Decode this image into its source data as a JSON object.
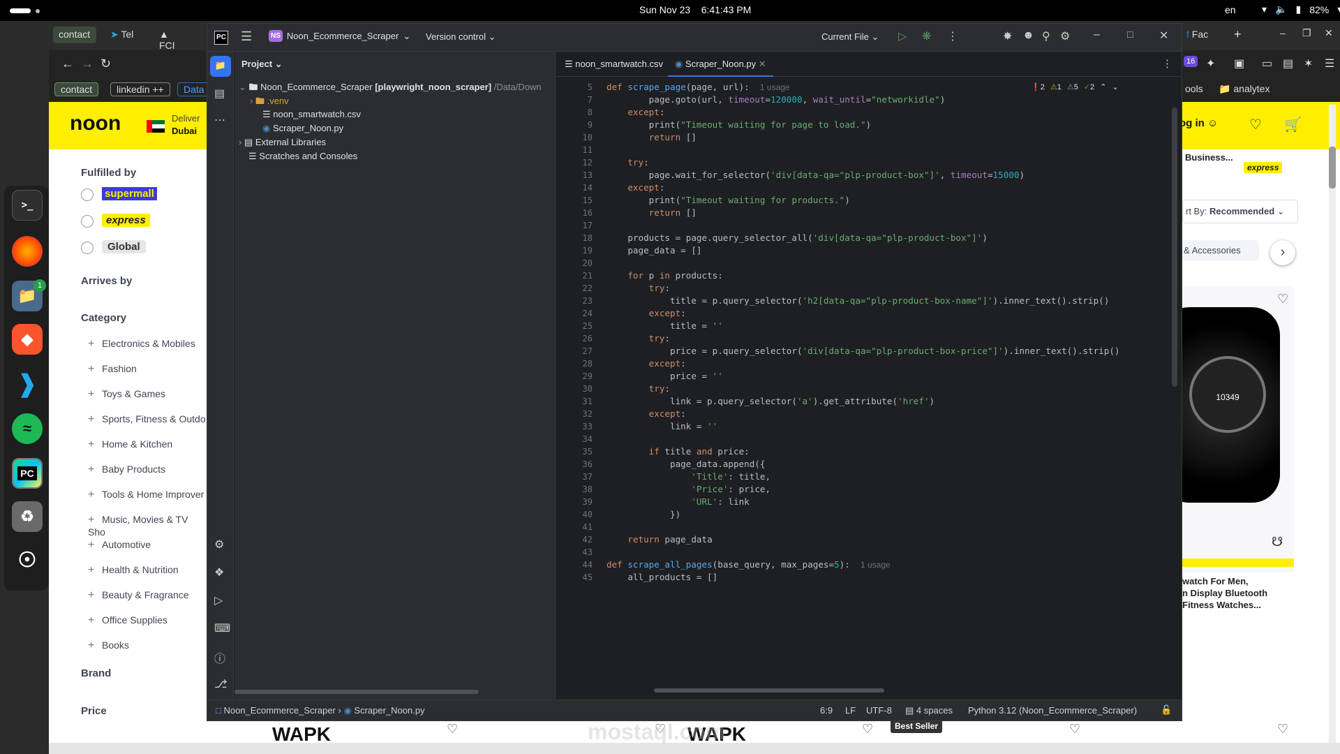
{
  "system": {
    "date": "Sun Nov 23",
    "time": "6:41:43 PM",
    "lang": "en",
    "battery": "82%"
  },
  "browser": {
    "tabs": [
      "contact",
      "Tel",
      "FCI",
      "Fac"
    ],
    "bookmarks": [
      "contact",
      "linkedin ++",
      "Data",
      "ools",
      "analytex"
    ],
    "badge16": "16"
  },
  "noon": {
    "logo": "noon",
    "deliver_to": "Deliver",
    "city": "Dubai",
    "sign_in": "og in",
    "fulfilled_by": "Fulfilled by",
    "fulfilled": [
      "supermall",
      "express",
      "Global"
    ],
    "arrives_by": "Arrives by",
    "category": "Category",
    "categories": [
      "Electronics & Mobiles",
      "Fashion",
      "Toys & Games",
      "Sports, Fitness & Outdo",
      "Home & Kitchen",
      "Baby Products",
      "Tools & Home Improver",
      "Music, Movies & TV Sho",
      "Automotive",
      "Health & Nutrition",
      "Beauty & Fragrance",
      "Office Supplies",
      "Books"
    ],
    "brand": "Brand",
    "price": "Price",
    "right_business": "Business...",
    "right_express": "express",
    "sort_by": "rt By:",
    "sort_value": "Recommended",
    "accessories": "& Accessories",
    "product_title": [
      "watch For Men,",
      "n Display Bluetooth",
      "Fitness Watches..."
    ],
    "best_seller": "Best Seller",
    "watch_text": "10349"
  },
  "ide": {
    "logo": "PC",
    "project_badge": "NS",
    "project_name": "Noon_Ecommerce_Scraper",
    "version_control": "Version control",
    "run_config": "Current File",
    "panel_title": "Project",
    "tree": {
      "root": "Noon_Ecommerce_Scraper",
      "root_branch": "[playwright_noon_scraper]",
      "root_path": "/Data/Down",
      "venv": ".venv",
      "csv": "noon_smartwatch.csv",
      "py": "Scraper_Noon.py",
      "ext": "External Libraries",
      "scratch": "Scratches and Consoles"
    },
    "tabs": [
      "noon_smartwatch.csv",
      "Scraper_Noon.py"
    ],
    "inspections": {
      "errors": "2",
      "warnings": "1",
      "weak": "5",
      "ok": "2"
    },
    "status": {
      "crumb1": "Noon_Ecommerce_Scraper",
      "crumb2": "Scraper_Noon.py",
      "pos": "6:9",
      "lf": "LF",
      "enc": "UTF-8",
      "indent": "4 spaces",
      "interp": "Python 3.12 (Noon_Ecommerce_Scraper)"
    },
    "line_numbers": [
      "5",
      "7",
      "8",
      "9",
      "10",
      "11",
      "12",
      "13",
      "14",
      "15",
      "16",
      "17",
      "18",
      "19",
      "20",
      "21",
      "22",
      "23",
      "24",
      "25",
      "26",
      "27",
      "28",
      "29",
      "30",
      "31",
      "32",
      "33",
      "34",
      "35",
      "36",
      "37",
      "38",
      "39",
      "40",
      "41",
      "42",
      "43",
      "44",
      "45"
    ]
  },
  "watermark": "mostaql.com",
  "colors": {
    "noon_yellow": "#feee00",
    "ide_bg": "#1e1f22",
    "ide_panel": "#2b2d30",
    "accent": "#3574f0"
  }
}
